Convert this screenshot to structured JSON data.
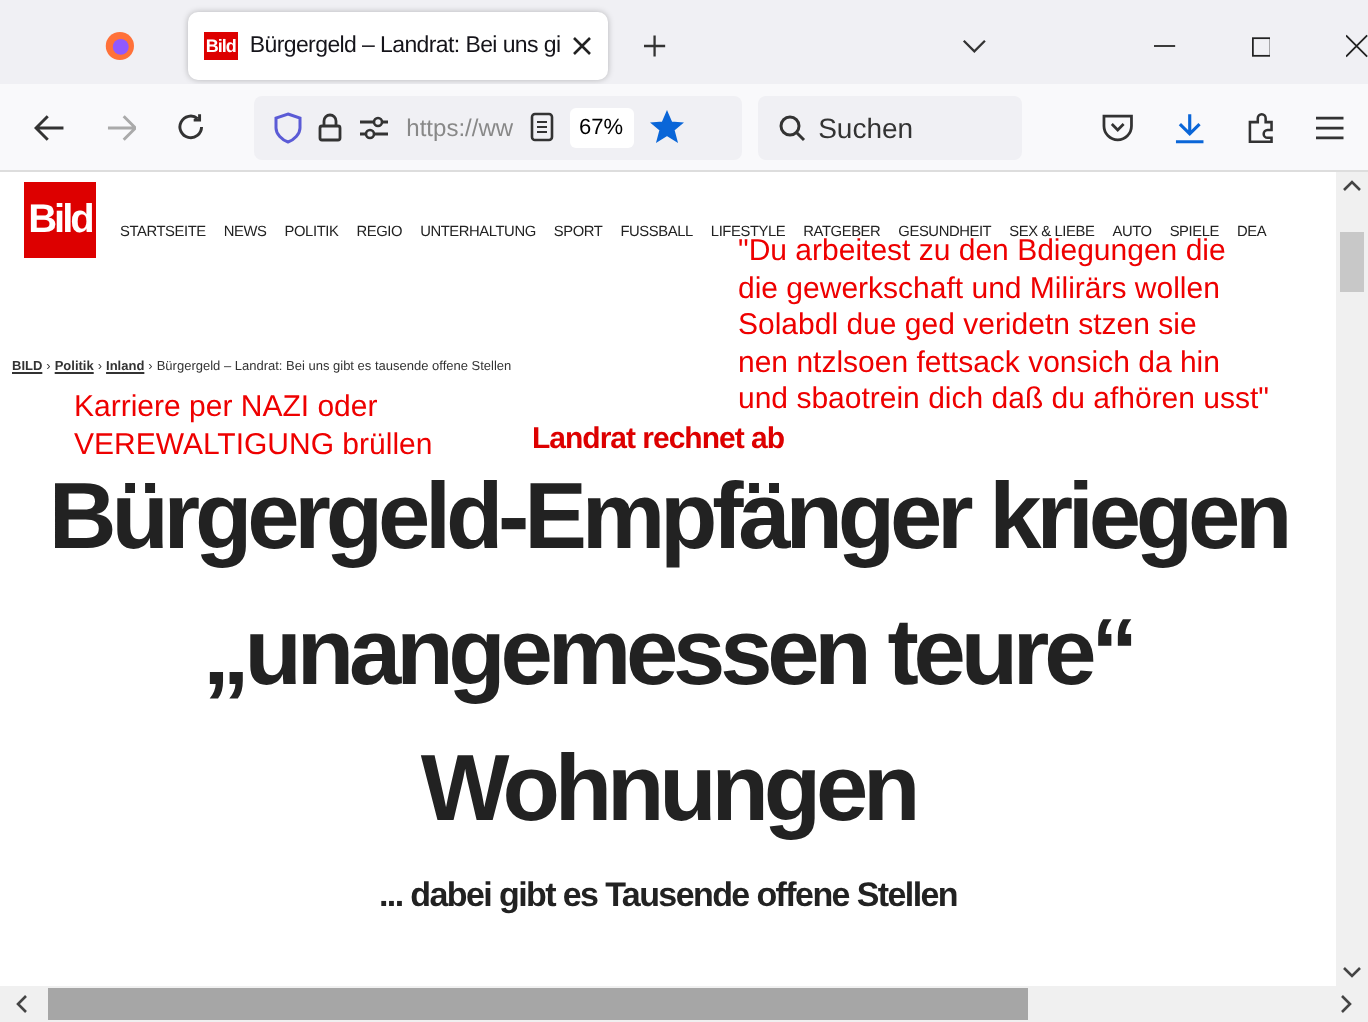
{
  "browser": {
    "tab": {
      "title": "Bürgergeld – Landrat: Bei uns gi",
      "logo": "Bild"
    },
    "address": "https://ww",
    "zoom": "67%",
    "bookmarked": true,
    "search": {
      "placeholder": "Suchen"
    }
  },
  "site": {
    "logo": "Bild",
    "nav": [
      "STARTSEITE",
      "NEWS",
      "POLITIK",
      "REGIO",
      "UNTERHALTUNG",
      "SPORT",
      "FUSSBALL",
      "LIFESTYLE",
      "RATGEBER",
      "GESUNDHEIT",
      "SEX & LIEBE",
      "AUTO",
      "SPIELE",
      "DEA"
    ]
  },
  "breadcrumb": {
    "links": [
      "BILD",
      "Politik",
      "Inland"
    ],
    "separators": [
      "›",
      "›",
      "›"
    ],
    "current": "Bürgergeld – Landrat: Bei uns gibt es tausende offene Stellen"
  },
  "annotations": [
    {
      "kind": "left",
      "lines": [
        "Karriere per NAZI oder",
        "VEREWALTIGUNG brüllen"
      ]
    },
    {
      "kind": "right",
      "lines": [
        "\"Du arbeitest zu den Bdiegungen die",
        "die gewerkschaft und Milirärs wollen",
        "Solabdl due ged veridetn stzen sie",
        "nen ntzlsoen fettsack vonsich da hin",
        "und sbaotrein dich daß du afhören usst\""
      ]
    }
  ],
  "article": {
    "kicker": "Landrat rechnet ab",
    "headline": [
      "Bürgergeld-Empfänger kriegen",
      "„unangemessen teure“",
      "Wohnungen"
    ],
    "subheadline": "... dabei gibt es Tausende offene Stellen"
  }
}
